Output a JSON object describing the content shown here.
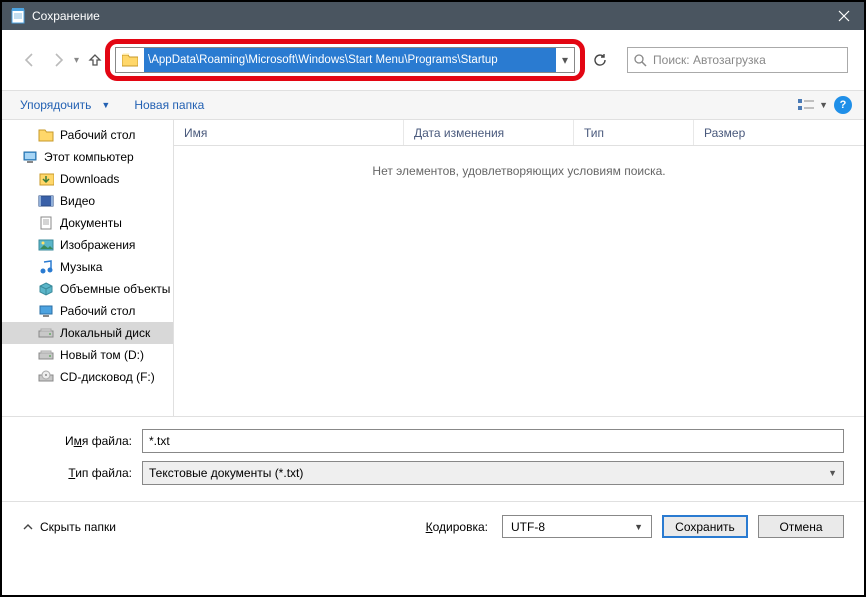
{
  "title": "Сохранение",
  "address_path": "\\AppData\\Roaming\\Microsoft\\Windows\\Start Menu\\Programs\\Startup",
  "search_placeholder": "Поиск: Автозагрузка",
  "toolbar": {
    "organize": "Упорядочить",
    "newfolder": "Новая папка"
  },
  "tree": [
    {
      "label": "Рабочий стол",
      "level": 1,
      "icon": "desktop"
    },
    {
      "label": "Этот компьютер",
      "level": 0,
      "icon": "thispc"
    },
    {
      "label": "Downloads",
      "level": 1,
      "icon": "downloads"
    },
    {
      "label": "Видео",
      "level": 1,
      "icon": "video"
    },
    {
      "label": "Документы",
      "level": 1,
      "icon": "documents"
    },
    {
      "label": "Изображения",
      "level": 1,
      "icon": "pictures"
    },
    {
      "label": "Музыка",
      "level": 1,
      "icon": "music"
    },
    {
      "label": "Объемные объекты",
      "level": 1,
      "icon": "3dobjects"
    },
    {
      "label": "Рабочий стол",
      "level": 1,
      "icon": "desktop2"
    },
    {
      "label": "Локальный диск",
      "level": 1,
      "icon": "drive",
      "selected": true
    },
    {
      "label": "Новый том (D:)",
      "level": 1,
      "icon": "drive"
    },
    {
      "label": "CD-дисковод (F:)",
      "level": 1,
      "icon": "cddrive"
    }
  ],
  "columns": {
    "name": "Имя",
    "date": "Дата изменения",
    "type": "Тип",
    "size": "Размер"
  },
  "empty_msg": "Нет элементов, удовлетворяющих условиям поиска.",
  "form": {
    "filename_label_pre": "И",
    "filename_label_u": "м",
    "filename_label_post": "я файла:",
    "filetype_label_pre": "",
    "filetype_label_u": "Т",
    "filetype_label_post": "ип файла:",
    "filename_value": "*.txt",
    "filetype_value": "Текстовые документы (*.txt)"
  },
  "footer": {
    "hide_folders": "Скрыть папки",
    "encoding_label_pre": "",
    "encoding_label_u": "К",
    "encoding_label_post": "одировка:",
    "encoding_value": "UTF-8",
    "save": "Сохранить",
    "cancel": "Отмена"
  }
}
